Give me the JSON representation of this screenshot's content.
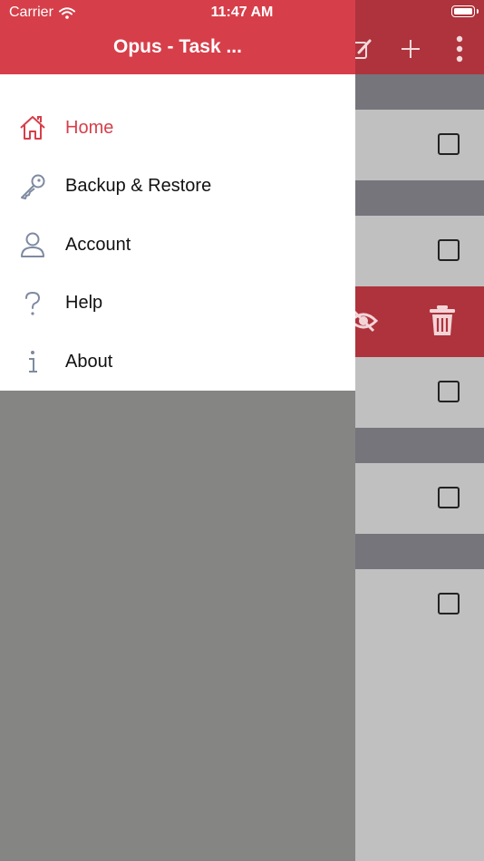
{
  "status_bar": {
    "carrier": "Carrier",
    "time": "11:47 AM"
  },
  "drawer": {
    "title": "Opus - Task ...",
    "items": [
      {
        "label": "Home",
        "icon": "home-icon",
        "active": true
      },
      {
        "label": "Backup & Restore",
        "icon": "key-icon"
      },
      {
        "label": "Account",
        "icon": "user-icon"
      },
      {
        "label": "Help",
        "icon": "question-icon"
      },
      {
        "label": "About",
        "icon": "info-icon"
      }
    ]
  },
  "background_app": {
    "header_actions": [
      "edit-icon",
      "add-icon",
      "more-icon"
    ],
    "swipe_actions": [
      "hide-icon",
      "trash-icon"
    ]
  },
  "colors": {
    "accent": "#d63f4a",
    "header_dim": "#ae333c",
    "icon_gray": "#7e8aa0",
    "overlay": "#858584"
  }
}
